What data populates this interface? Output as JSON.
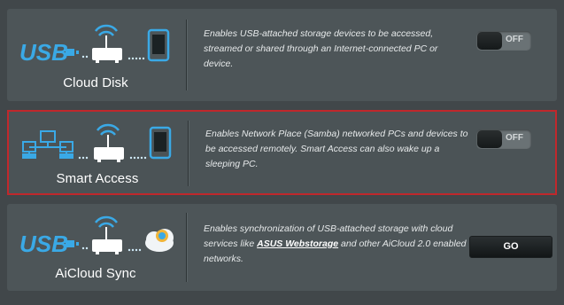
{
  "services": [
    {
      "name": "Cloud Disk",
      "description": "Enables USB-attached storage devices to be accessed, streamed or shared through an Internet-connected PC or device.",
      "control": "OFF"
    },
    {
      "name": "Smart Access",
      "description": "Enables Network Place (Samba) networked PCs and devices to be accessed remotely. Smart Access can also wake up a sleeping PC.",
      "control": "OFF"
    },
    {
      "name": "AiCloud Sync",
      "description_before": "Enables synchronization of USB-attached storage with cloud services like ",
      "description_link": "ASUS Webstorage",
      "description_after": " and other AiCloud 2.0 enabled networks.",
      "control": "GO"
    }
  ],
  "icons": {
    "usb": "usb-icon",
    "router": "router-icon",
    "phone": "phone-icon",
    "computers": "networked-computers-icon",
    "cloud": "cloud-icon"
  },
  "colors": {
    "accent_border": "#c0282c",
    "icon_blue": "#3aa9e6"
  }
}
